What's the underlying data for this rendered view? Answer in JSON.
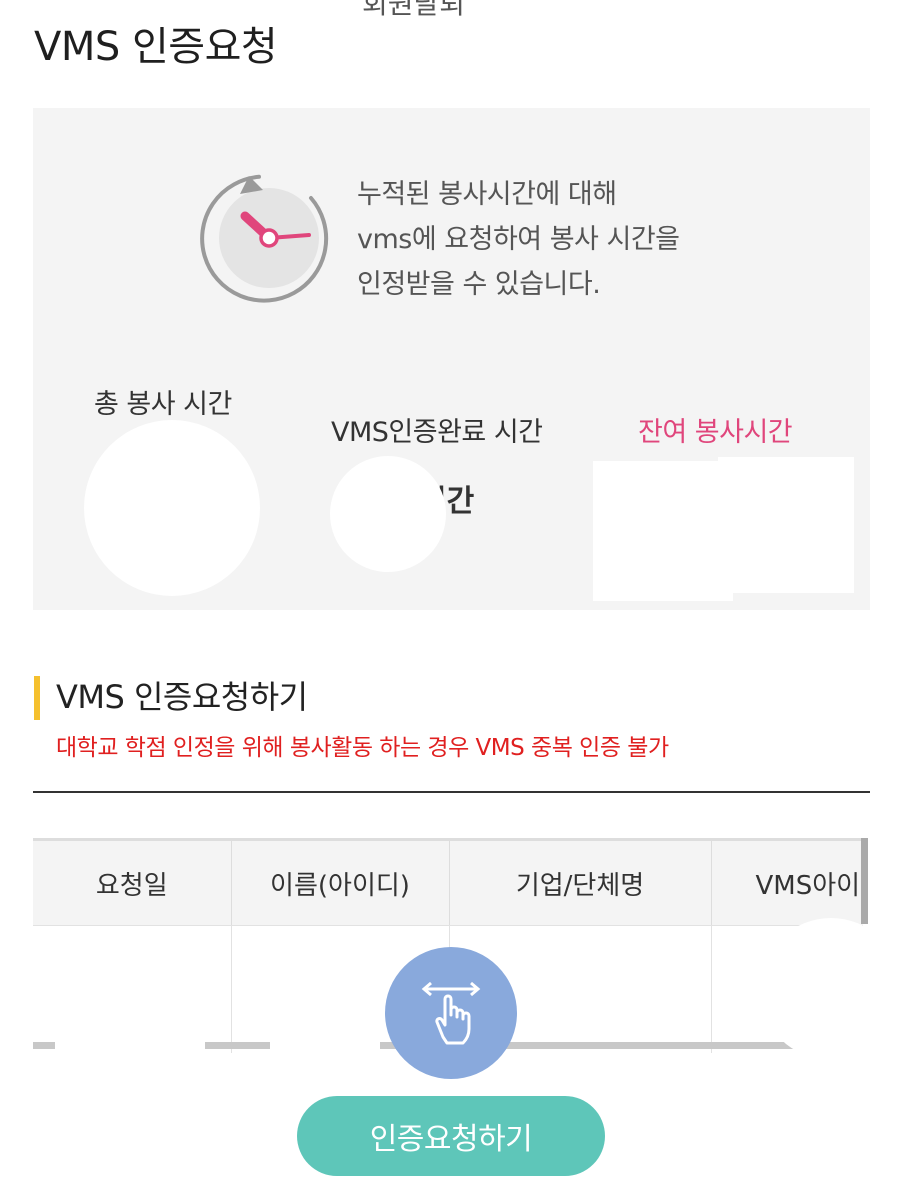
{
  "header": {
    "title": "VMS 인증요청",
    "top_cut_text": "회원탈퇴"
  },
  "info_panel": {
    "description_lines": [
      "누적된 봉사시간에 대해",
      "vms에 요청하여 봉사 시간을",
      "인정받을 수 있습니다."
    ],
    "stats": {
      "total_label": "총 봉사 시간",
      "completed_label": "VMS인증완료 시간",
      "completed_value": "시간",
      "remaining_label": "잔여 봉사시간"
    }
  },
  "section": {
    "title": "VMS 인증요청하기",
    "warning": "대학교 학점 인정을 위해 봉사활동 하는 경우 VMS 중복 인증 불가"
  },
  "table": {
    "columns": [
      "요청일",
      "이름(아이디)",
      "기업/단체명",
      "VMS아이디"
    ]
  },
  "cta": {
    "label": "인증요청하기"
  },
  "colors": {
    "accent_pink": "#e0467c",
    "warning_red": "#e02020",
    "section_bar_yellow": "#f5c02e",
    "button_teal": "#5ec6b9",
    "swipe_blue": "#89a9dc"
  },
  "icons": [
    "clock-icon",
    "swipe-hand-icon"
  ]
}
